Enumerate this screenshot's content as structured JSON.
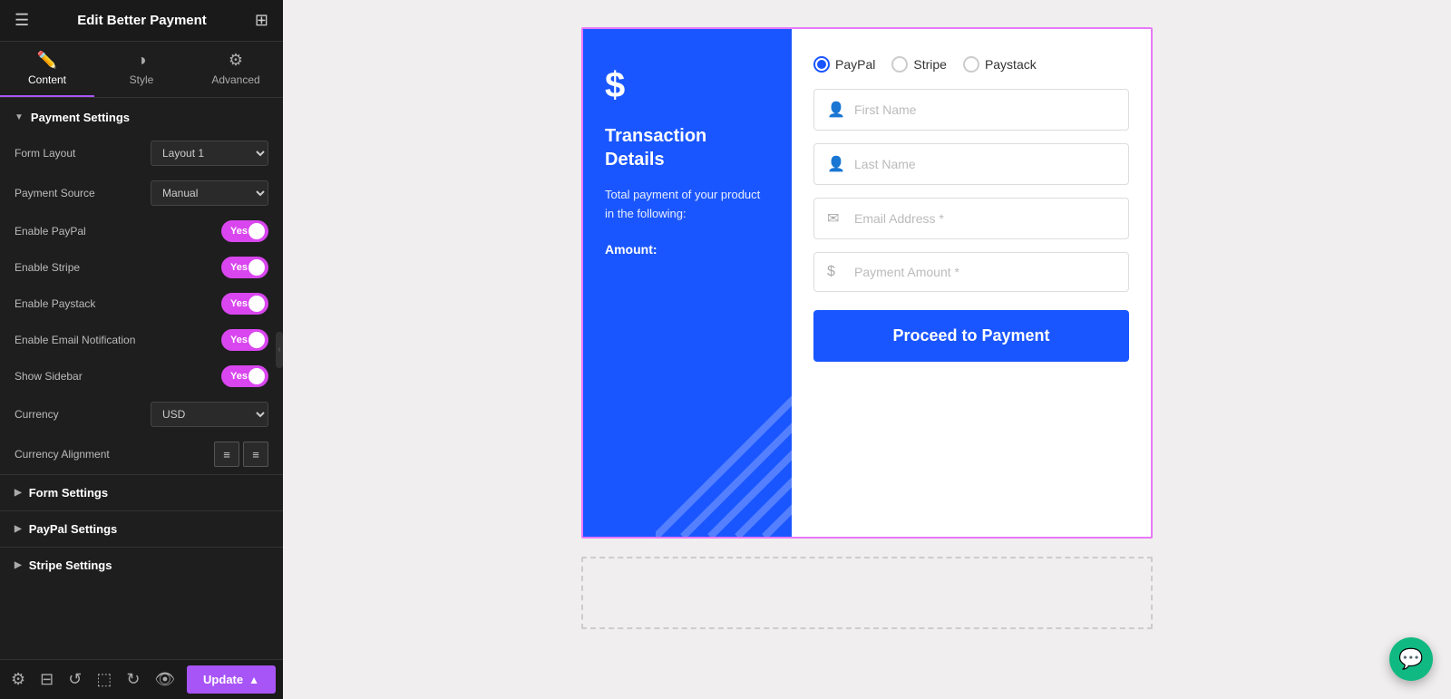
{
  "header": {
    "title": "Edit Better Payment",
    "menu_icon": "☰",
    "grid_icon": "⊞"
  },
  "tabs": [
    {
      "id": "content",
      "label": "Content",
      "icon": "✏️",
      "active": true
    },
    {
      "id": "style",
      "label": "Style",
      "icon": "◑",
      "active": false
    },
    {
      "id": "advanced",
      "label": "Advanced",
      "icon": "⚙",
      "active": false
    }
  ],
  "payment_settings": {
    "section_label": "Payment Settings",
    "form_layout_label": "Form Layout",
    "form_layout_value": "Layout 1",
    "payment_source_label": "Payment Source",
    "payment_source_value": "Manual",
    "enable_paypal_label": "Enable PayPal",
    "enable_paypal_value": "Yes",
    "enable_stripe_label": "Enable Stripe",
    "enable_stripe_value": "Yes",
    "enable_paystack_label": "Enable Paystack",
    "enable_paystack_value": "Yes",
    "enable_email_notification_label": "Enable Email Notification",
    "enable_email_notification_value": "Yes",
    "show_sidebar_label": "Show Sidebar",
    "show_sidebar_value": "Yes",
    "currency_label": "Currency",
    "currency_value": "USD",
    "currency_alignment_label": "Currency Alignment"
  },
  "collapsed_sections": [
    {
      "id": "form-settings",
      "label": "Form Settings"
    },
    {
      "id": "paypal-settings",
      "label": "PayPal Settings"
    },
    {
      "id": "stripe-settings",
      "label": "Stripe Settings"
    }
  ],
  "widget": {
    "dollar_sign": "$",
    "title": "Transaction Details",
    "description": "Total payment of your product in the following:",
    "amount_label": "Amount:",
    "radio_options": [
      {
        "id": "paypal",
        "label": "PayPal",
        "checked": true
      },
      {
        "id": "stripe",
        "label": "Stripe",
        "checked": false
      },
      {
        "id": "paystack",
        "label": "Paystack",
        "checked": false
      }
    ],
    "fields": [
      {
        "id": "first-name",
        "placeholder": "First Name",
        "icon": "👤",
        "required": false
      },
      {
        "id": "last-name",
        "placeholder": "Last Name",
        "icon": "👤",
        "required": false
      },
      {
        "id": "email",
        "placeholder": "Email Address",
        "icon": "✉",
        "required": true
      },
      {
        "id": "amount",
        "placeholder": "Payment Amount",
        "icon": "$",
        "required": true
      }
    ],
    "button_label": "Proceed to Payment"
  },
  "footer": {
    "update_label": "Update"
  }
}
